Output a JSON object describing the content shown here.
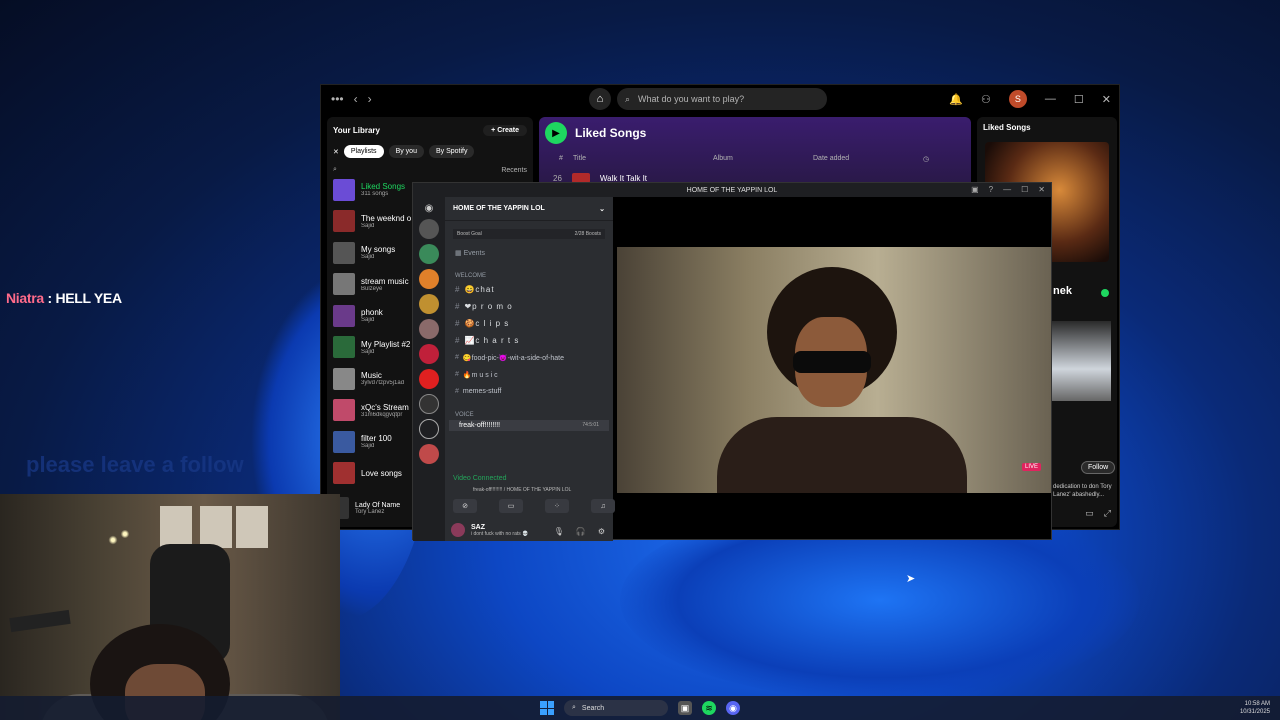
{
  "overlay": {
    "chat_name": "Niatra",
    "chat_sep": " : ",
    "chat_message": "HELL YEA",
    "watermark": "please leave a follow"
  },
  "spotify": {
    "search_placeholder": "What do you want to play?",
    "avatar_letter": "S",
    "library": {
      "title": "Your Library",
      "create_label": "Create",
      "chips": [
        "Playlists",
        "By you",
        "By Spotify"
      ],
      "sort_label": "Recents",
      "items": [
        {
          "title": "Liked Songs",
          "meta": "311 songs",
          "color": "#6b4cd6"
        },
        {
          "title": "The weeknd o",
          "meta": "Sajid",
          "color": "#8a2a2a"
        },
        {
          "title": "My songs",
          "meta": "Sajid",
          "color": "#555"
        },
        {
          "title": "stream music",
          "meta": "Bulzeye",
          "color": "#777"
        },
        {
          "title": "phonk",
          "meta": "Sajid",
          "color": "#6a3a8a"
        },
        {
          "title": "My Playlist #2",
          "meta": "Sajid",
          "color": "#2a6a3a"
        },
        {
          "title": "Music",
          "meta": "3ylvd7tzpv5j1ad",
          "color": "#888"
        },
        {
          "title": "xQc's Stream",
          "meta": "31m6dkqgvqtpr",
          "color": "#c04a6a"
        },
        {
          "title": "filter 100",
          "meta": "Sajid",
          "color": "#3a5aa0"
        },
        {
          "title": "Love songs",
          "meta": "",
          "color": "#a03030"
        }
      ]
    },
    "liked": {
      "title": "Liked Songs",
      "col_index": "#",
      "col_title": "Title",
      "col_album": "Album",
      "col_date": "Date added",
      "row_num": "26",
      "row_title": "Walk It Talk It"
    },
    "now_playing": {
      "header": "Liked Songs",
      "artist_partial": "nek",
      "follow_label": "Follow",
      "desc": "dedication to don Tory Lanez' abashedly..."
    },
    "playing": {
      "title": "Lady Of Name",
      "artist": "Tory Lanez"
    }
  },
  "discord": {
    "window_title": "HOME OF THE YAPPIN LOL",
    "server_name": "HOME OF THE YAPPIN LOL",
    "boost_label": "Boost Goal",
    "boost_count": "2/28 Boosts",
    "events_label": "Events",
    "welcome_cat": "WELCOME",
    "channels": [
      "😄chat",
      "❤p r o m o",
      "🍪c l i p s",
      "📈c h a r t s",
      "😋food-pic-😈-wit-a-side-of-hate",
      "🔥m u s i c",
      "memes-stuff"
    ],
    "voice_cat": "VOICE",
    "voice_channel": "freak-off!!!!!!!!",
    "voice_time": "74:5:01",
    "video_connected": "Video Connected",
    "vc_sub": "freak-off!!!!!!!! / HOME OF THE YAPPIN LOL",
    "user_name": "SAZ",
    "user_status": "i dont fuck with no rats 💀",
    "live_label": "LIVE"
  },
  "taskbar": {
    "search_label": "Search",
    "time": "10:58 AM",
    "date": "10/31/2025"
  }
}
